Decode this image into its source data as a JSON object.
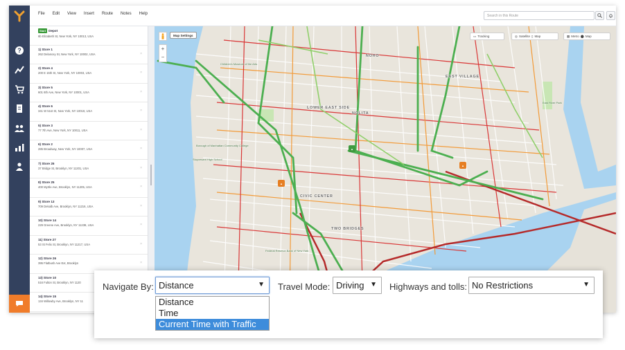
{
  "menu": {
    "items": [
      "File",
      "Edit",
      "View",
      "Insert",
      "Route",
      "Notes",
      "Help"
    ],
    "search_placeholder": "Search in this Route"
  },
  "rail": {
    "icons": [
      "help-icon",
      "routes-icon",
      "cart-icon",
      "document-icon",
      "team-icon",
      "analytics-icon",
      "user-icon"
    ],
    "chat_icon": "chat-icon",
    "accent": "#f07c2a",
    "background": "#33415e"
  },
  "stops": [
    {
      "title": "Depot",
      "start_badge": "Start",
      "address": "6b Elizabeth St, New York, NY 10013, USA"
    },
    {
      "title": "1) Store 1",
      "address": "262 Delancey St, New York, NY 10002, USA"
    },
    {
      "title": "2) Store 4",
      "address": "200 E 15th St, New York, NY 10003, USA"
    },
    {
      "title": "3) Store 5",
      "address": "601 6th Ave, New York, NY 10001, USA"
    },
    {
      "title": "4) Store 6",
      "address": "341 W 51st St, New York, NY 10019, USA"
    },
    {
      "title": "5) Store 3",
      "address": "77 7th Ave, New York, NY 10011, USA"
    },
    {
      "title": "6) Store 2",
      "address": "285 Broadway, New York, NY 10007, USA"
    },
    {
      "title": "7) Store 26",
      "address": "37 Bridge St, Brooklyn, NY 11201, USA"
    },
    {
      "title": "8) Store 25",
      "address": "400 Myrtle Ave, Brooklyn, NY 11205, USA"
    },
    {
      "title": "9) Store 13",
      "address": "709 Dekalb Ave, Brooklyn, NY 11216, USA"
    },
    {
      "title": "10) Store 14",
      "address": "229 Greene Ave, Brooklyn, NY 11238, USA"
    },
    {
      "title": "11) Store 27",
      "address": "53 St Felix St, Brooklyn, NY 11217, USA"
    },
    {
      "title": "12) Store 26",
      "address": "395 Flatbush Ave Ext, Brooklyn"
    },
    {
      "title": "13) Store 10",
      "address": "516 Fulton St, Brooklyn, NY 1120"
    },
    {
      "title": "14) Store 15",
      "address": "134 Willowby Ave, Brooklyn, NY 11"
    }
  ],
  "map": {
    "settings_label": "Map Settings",
    "tracking_label": "Tracking",
    "satellite_label": "Satellite",
    "map_label": "Map",
    "metro_label": "Metro",
    "map_pin_label": "Map",
    "zoom_in": "+",
    "zoom_out": "−",
    "labels": {
      "noho": "NOHO",
      "east_village": "EAST VILLAGE",
      "lower_east_side": "LOWER EAST SIDE",
      "nolita": "NOLITA",
      "civic_center": "CIVIC CENTER",
      "two_bridges": "TWO BRIDGES",
      "childrens_museum": "Children's Museum of the Arts",
      "bmcc": "Borough of Manhattan Community College",
      "stuyvesant": "Stuyvesant High School",
      "federal_reserve": "Federal Reserve Bank of New York",
      "east_river_park": "East River Park"
    }
  },
  "navigate_panel": {
    "navigate_by_label": "Navigate By:",
    "navigate_by_value": "Distance",
    "navigate_by_options": [
      "Distance",
      "Time",
      "Current Time with Traffic"
    ],
    "navigate_by_highlighted": "Current Time with Traffic",
    "travel_mode_label": "Travel Mode:",
    "travel_mode_value": "Driving",
    "highways_label": "Highways and tolls:",
    "highways_value": "No Restrictions",
    "arrow": "▼"
  }
}
